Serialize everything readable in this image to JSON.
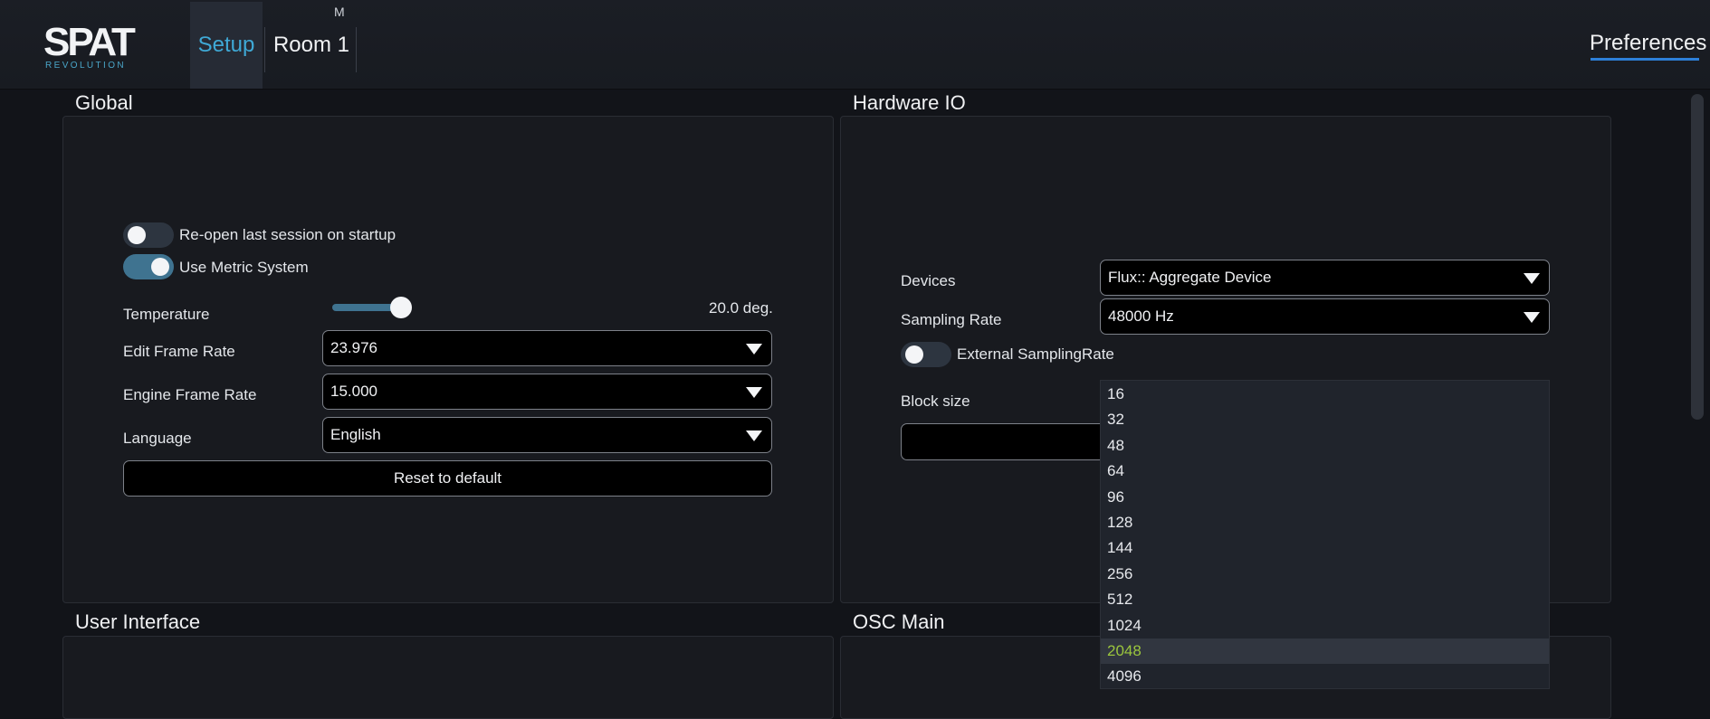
{
  "header": {
    "logo_text": "SPAT",
    "logo_sub": "REVOLUTION",
    "tabs": [
      {
        "label": "Setup",
        "active": true
      },
      {
        "label": "Room 1",
        "badge": "M"
      }
    ],
    "preferences_label": "Preferences",
    "accent_color": "#3fa9d6"
  },
  "global": {
    "title": "Global",
    "reopen_label": "Re-open last session on startup",
    "reopen_on": false,
    "metric_label": "Use Metric System",
    "metric_on": true,
    "temperature_label": "Temperature",
    "temperature_value": "20.0 deg.",
    "edit_frame_rate_label": "Edit Frame Rate",
    "edit_frame_rate_value": "23.976",
    "engine_frame_rate_label": "Engine Frame Rate",
    "engine_frame_rate_value": "15.000",
    "language_label": "Language",
    "language_value": "English",
    "reset_label": "Reset to default"
  },
  "hardware": {
    "title": "Hardware IO",
    "devices_label": "Devices",
    "devices_value": "Flux:: Aggregate Device",
    "sampling_rate_label": "Sampling Rate",
    "sampling_rate_value": "48000 Hz",
    "external_label": "External SamplingRate",
    "external_on": false,
    "block_size_label": "Block size",
    "block_size_options": [
      "16",
      "32",
      "48",
      "64",
      "96",
      "128",
      "144",
      "256",
      "512",
      "1024",
      "2048",
      "4096"
    ],
    "block_size_selected": "2048",
    "selected_color": "#9bc63d"
  },
  "user_interface": {
    "title": "User Interface"
  },
  "osc_main": {
    "title": "OSC Main"
  }
}
